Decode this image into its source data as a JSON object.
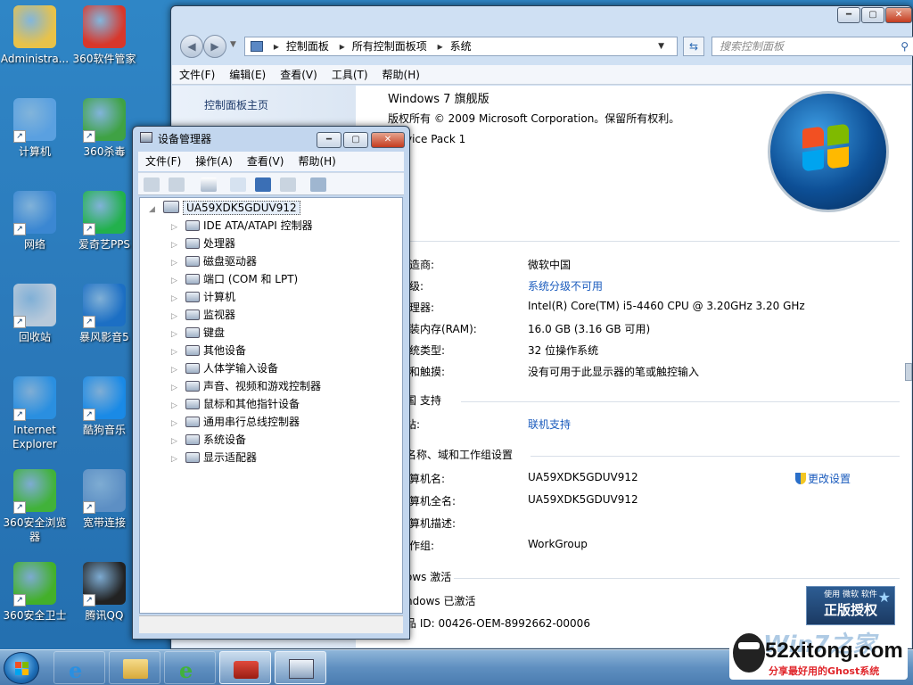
{
  "desktop": {
    "icons": [
      {
        "label": "Administra...",
        "icon": "user-folder-icon",
        "color": "#e8c24a"
      },
      {
        "label": "360软件管家",
        "icon": "360-software-manager-icon",
        "color": "#d8372b"
      },
      {
        "label": "计算机",
        "icon": "computer-icon",
        "color": "#5aa0e0"
      },
      {
        "label": "360杀毒",
        "icon": "360-antivirus-icon",
        "color": "#3fa244"
      },
      {
        "label": "网络",
        "icon": "network-icon",
        "color": "#3b87d2"
      },
      {
        "label": "爱奇艺PPS",
        "icon": "iqiyi-icon",
        "color": "#22b14c"
      },
      {
        "label": "回收站",
        "icon": "recycle-bin-icon",
        "color": "#b8c9da"
      },
      {
        "label": "暴风影音5",
        "icon": "baofeng-player-icon",
        "color": "#1c6fc4"
      },
      {
        "label": "Internet Explorer",
        "icon": "internet-explorer-icon",
        "color": "#2a8fe0"
      },
      {
        "label": "酷狗音乐",
        "icon": "kugou-music-icon",
        "color": "#1a8ae6"
      },
      {
        "label": "360安全浏览器",
        "icon": "360-browser-icon",
        "color": "#41b23a"
      },
      {
        "label": "宽带连接",
        "icon": "broadband-connection-icon",
        "color": "#5d8fc4"
      },
      {
        "label": "360安全卫士",
        "icon": "360-security-guard-icon",
        "color": "#43b02a"
      },
      {
        "label": "腾讯QQ",
        "icon": "qq-penguin-icon",
        "color": "#222222"
      }
    ]
  },
  "control_panel": {
    "breadcrumb": [
      "控制面板",
      "所有控制面板项",
      "系统"
    ],
    "search_placeholder": "搜索控制面板",
    "menu": [
      "文件(F)",
      "编辑(E)",
      "查看(V)",
      "工具(T)",
      "帮助(H)"
    ],
    "nav_home": "控制面板主页",
    "edition": "Windows 7 旗舰版",
    "copyright": "版权所有 © 2009 Microsoft Corporation。保留所有权利。",
    "service_pack": "vice Pack 1",
    "system_rows": [
      {
        "label": "造商:",
        "value": "微软中国",
        "link": false
      },
      {
        "label": "级:",
        "value": "系统分级不可用",
        "link": true
      },
      {
        "label": "理器:",
        "value": "Intel(R) Core(TM) i5-4460  CPU @ 3.20GHz   3.20 GHz",
        "link": false
      },
      {
        "label": "装内存(RAM):",
        "value": "16.0 GB (3.16 GB 可用)",
        "link": false
      },
      {
        "label": "统类型:",
        "value": "32 位操作系统",
        "link": false
      },
      {
        "label": "和触摸:",
        "value": "没有可用于此显示器的笔或触控输入",
        "link": false
      }
    ],
    "support_header": "国 支持",
    "support_row": {
      "label": "站:",
      "value": "联机支持"
    },
    "name_header": "名称、域和工作组设置",
    "name_rows": [
      {
        "label": "算机名:",
        "value": "UA59XDK5GDUV912"
      },
      {
        "label": "算机全名:",
        "value": "UA59XDK5GDUV912"
      },
      {
        "label": "算机描述:",
        "value": ""
      },
      {
        "label": "作组:",
        "value": "WorkGroup"
      }
    ],
    "change_settings": "更改设置",
    "activation_header": "ows 激活",
    "activation_status": "ndows 已激活",
    "product_id": "品 ID: 00426-OEM-8992662-00006",
    "genuine_badge_small": "使用 微软 软件",
    "genuine_badge": "正版授权"
  },
  "device_manager": {
    "title": "设备管理器",
    "menu": [
      "文件(F)",
      "操作(A)",
      "查看(V)",
      "帮助(H)"
    ],
    "root": "UA59XDK5GDUV912",
    "nodes": [
      "IDE ATA/ATAPI 控制器",
      "处理器",
      "磁盘驱动器",
      "端口 (COM 和 LPT)",
      "计算机",
      "监视器",
      "键盘",
      "其他设备",
      "人体学输入设备",
      "声音、视频和游戏控制器",
      "鼠标和其他指针设备",
      "通用串行总线控制器",
      "系统设备",
      "显示适配器"
    ]
  },
  "watermark": {
    "site": "52xitong.com",
    "brand": "Win7之家",
    "tagline": "分享最好用的Ghost系统"
  },
  "colors": {
    "desktop": "#2b7bb9",
    "link": "#1a5bbd",
    "watermark_red": "#e0262b"
  }
}
